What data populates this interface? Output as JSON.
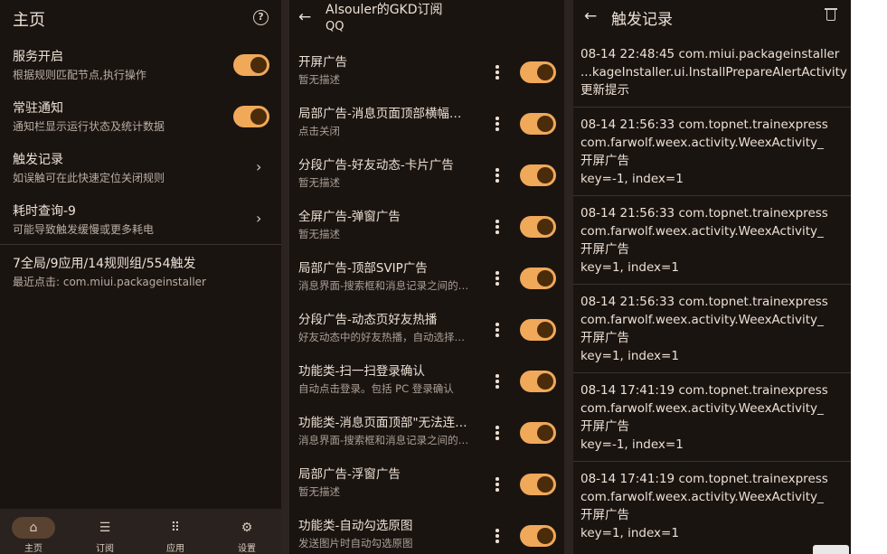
{
  "home": {
    "title": "主页",
    "settings": [
      {
        "title": "服务开启",
        "sub": "根据规则匹配节点,执行操作",
        "control": "toggle",
        "on": true
      },
      {
        "title": "常驻通知",
        "sub": "通知栏显示运行状态及统计数据",
        "control": "toggle",
        "on": true
      },
      {
        "title": "触发记录",
        "sub": "如误触可在此快速定位关闭规则",
        "control": "chevron"
      },
      {
        "title": "耗时查询-9",
        "sub": "可能导致触发缓慢或更多耗电",
        "control": "chevron"
      }
    ],
    "stats": {
      "title": "7全局/9应用/14规则组/554触发",
      "sub": "最近点击: com.miui.packageinstaller"
    },
    "nav": [
      {
        "label": "主页",
        "icon": "⌂",
        "active": true
      },
      {
        "label": "订阅",
        "icon": "☰",
        "active": false
      },
      {
        "label": "应用",
        "icon": "⠿",
        "active": false
      },
      {
        "label": "设置",
        "icon": "⚙",
        "active": false
      }
    ]
  },
  "subscription": {
    "title": "AIsouler的GKD订阅",
    "subtitle": "QQ",
    "rules": [
      {
        "title": "开屏广告",
        "sub": "暂无描述",
        "on": true
      },
      {
        "title": "局部广告-消息页面顶部横幅广告",
        "sub": "点击关闭",
        "on": true
      },
      {
        "title": "分段广告-好友动态-卡片广告",
        "sub": "暂无描述",
        "on": true
      },
      {
        "title": "全屏广告-弹窗广告",
        "sub": "暂无描述",
        "on": true
      },
      {
        "title": "局部广告-顶部SVIP广告",
        "sub": "消息界面-搜索框和消息记录之间的广告",
        "on": true
      },
      {
        "title": "分段广告-动态页好友热播",
        "sub": "好友动态中的好友热播，自动选择关闭",
        "on": true
      },
      {
        "title": "功能类-扫一扫登录确认",
        "sub": "自动点击登录。包括 PC 登录确认",
        "on": true
      },
      {
        "title": "功能类-消息页面顶部\"无法连接网络\"",
        "sub": "消息界面-搜索框和消息记录之间的提示",
        "on": true
      },
      {
        "title": "局部广告-浮窗广告",
        "sub": "暂无描述",
        "on": true
      },
      {
        "title": "功能类-自动勾选原图",
        "sub": "发送图片时自动勾选原图",
        "on": true
      }
    ]
  },
  "trigger_log": {
    "title": "触发记录",
    "entries": [
      {
        "lines": [
          "08-14 22:48:45  com.miui.packageinstaller",
          "...kageInstaller.ui.InstallPrepareAlertActivity",
          "更新提示"
        ]
      },
      {
        "lines": [
          "08-14 21:56:33  com.topnet.trainexpress",
          "com.farwolf.weex.activity.WeexActivity_",
          "开屏广告",
          "key=-1, index=1"
        ]
      },
      {
        "lines": [
          "08-14 21:56:33  com.topnet.trainexpress",
          "com.farwolf.weex.activity.WeexActivity_",
          "开屏广告",
          "key=1, index=1"
        ]
      },
      {
        "lines": [
          "08-14 21:56:33  com.topnet.trainexpress",
          "com.farwolf.weex.activity.WeexActivity_",
          "开屏广告",
          "key=1, index=1"
        ]
      },
      {
        "lines": [
          "08-14 17:41:19  com.topnet.trainexpress",
          "com.farwolf.weex.activity.WeexActivity_",
          "开屏广告",
          "key=-1, index=1"
        ]
      },
      {
        "lines": [
          "08-14 17:41:19  com.topnet.trainexpress",
          "com.farwolf.weex.activity.WeexActivity_",
          "开屏广告",
          "key=1, index=1"
        ]
      }
    ]
  },
  "colors": {
    "accent": "#f0a859",
    "background": "#1a1411"
  }
}
